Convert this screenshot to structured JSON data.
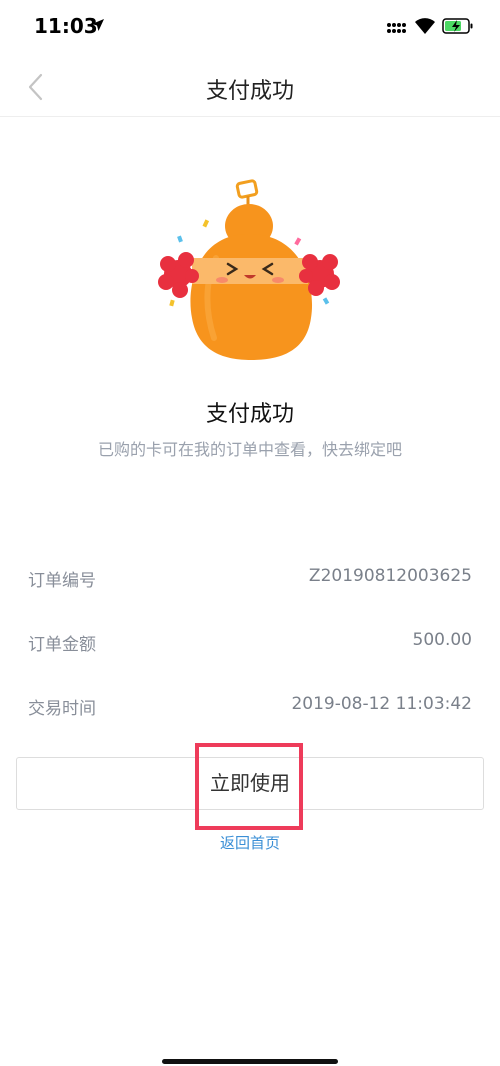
{
  "status_bar": {
    "time": "11:03"
  },
  "nav": {
    "title": "支付成功",
    "back_icon": "chevron-left-icon"
  },
  "success": {
    "title": "支付成功",
    "subtitle": "已购的卡可在我的订单中查看，快去绑定吧",
    "mascot_icon": "cheering-gourd-mascot"
  },
  "order": {
    "rows": [
      {
        "label": "订单编号",
        "value": "Z20190812003625"
      },
      {
        "label": "订单金额",
        "value": "500.00"
      },
      {
        "label": "交易时间",
        "value": "2019-08-12 11:03:42"
      }
    ]
  },
  "actions": {
    "use_now_label": "立即使用",
    "return_home_label": "返回首页"
  },
  "colors": {
    "accent": "#3b8fd6",
    "highlight": "#ee3b5a",
    "mascot": "#f7941d"
  }
}
